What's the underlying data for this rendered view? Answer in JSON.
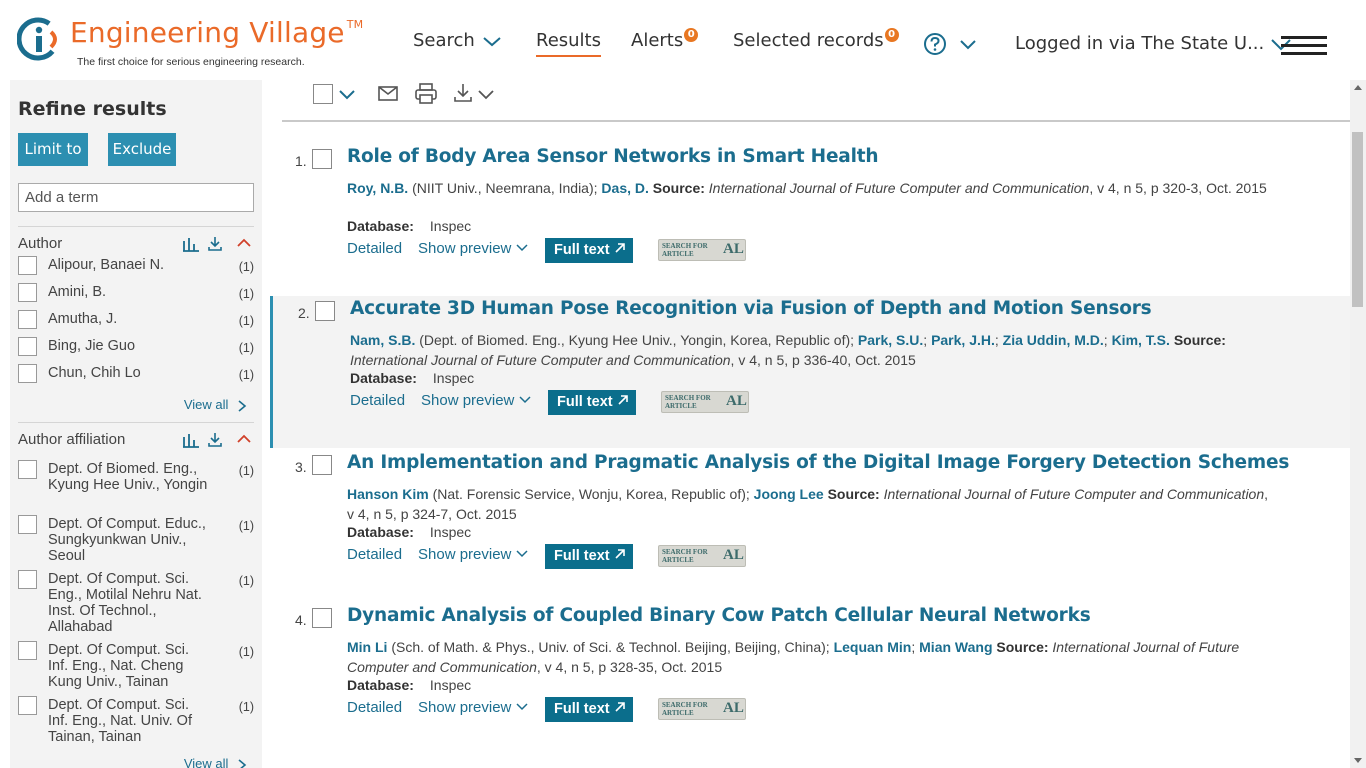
{
  "header": {
    "logo_title": "Engineering Village",
    "logo_tm": "TM",
    "logo_tagline": "The first choice for serious engineering research.",
    "nav_search": "Search",
    "nav_results": "Results",
    "nav_alerts": "Alerts",
    "alerts_count": "0",
    "nav_selected": "Selected records",
    "selected_count": "0",
    "login": "Logged in via The State U..."
  },
  "sidebar": {
    "title": "Refine results",
    "limit_label": "Limit to",
    "exclude_label": "Exclude",
    "term_placeholder": "Add a term",
    "author": {
      "label": "Author",
      "items": [
        {
          "name": "Alipour, Banaei N.",
          "count": "(1)"
        },
        {
          "name": "Amini, B.",
          "count": "(1)"
        },
        {
          "name": "Amutha, J.",
          "count": "(1)"
        },
        {
          "name": "Bing, Jie Guo",
          "count": "(1)"
        },
        {
          "name": "Chun, Chih Lo",
          "count": "(1)"
        }
      ],
      "view_all": "View all"
    },
    "affiliation": {
      "label": "Author affiliation",
      "items": [
        {
          "name": "Dept. Of Biomed. Eng., Kyung Hee Univ., Yongin",
          "count": "(1)"
        },
        {
          "name": "Dept. Of Comput. Educ., Sungkyunkwan Univ., Seoul",
          "count": "(1)"
        },
        {
          "name": "Dept. Of Comput. Sci. Eng., Motilal Nehru Nat. Inst. Of Technol., Allahabad",
          "count": "(1)"
        },
        {
          "name": "Dept. Of Comput. Sci. Inf. Eng., Nat. Cheng Kung Univ., Tainan",
          "count": "(1)"
        },
        {
          "name": "Dept. Of Comput. Sci. Inf. Eng., Nat. Univ. Of Tainan, Tainan",
          "count": "(1)"
        }
      ],
      "view_all": "View all"
    }
  },
  "results": [
    {
      "num": "1.",
      "title": "Role of Body Area Sensor Networks in Smart Health",
      "authors": [
        {
          "name": "Roy, N.B.",
          "aff": " (NIIT Univ., Neemrana, India); "
        },
        {
          "name": "Das, D.",
          "aff": " "
        }
      ],
      "source_label": "Source:",
      "journal": "International Journal of Future Computer and Communication",
      "details": ", v 4, n 5, p 320-3, Oct. 2015",
      "db_label": "Database:",
      "db": "Inspec"
    },
    {
      "num": "2.",
      "title": "Accurate 3D Human Pose Recognition via Fusion of Depth and Motion Sensors",
      "authors": [
        {
          "name": "Nam, S.B.",
          "aff": " (Dept. of Biomed. Eng., Kyung Hee Univ., Yongin, Korea, Republic of); "
        },
        {
          "name": "Park, S.U.",
          "aff": "; "
        },
        {
          "name": "Park, J.H.",
          "aff": "; "
        },
        {
          "name": "Zia Uddin, M.D.",
          "aff": "; "
        },
        {
          "name": "Kim, T.S.",
          "aff": " "
        }
      ],
      "source_label": "Source:",
      "journal": "International Journal of Future Computer and Communication",
      "details": ", v 4, n 5, p 336-40, Oct. 2015",
      "db_label": "Database:",
      "db": "Inspec"
    },
    {
      "num": "3.",
      "title": "An Implementation and Pragmatic Analysis of the Digital Image Forgery Detection Schemes",
      "authors": [
        {
          "name": "Hanson Kim",
          "aff": " (Nat. Forensic Service, Wonju, Korea, Republic of); "
        },
        {
          "name": "Joong Lee",
          "aff": " "
        }
      ],
      "source_label": "Source:",
      "journal": "International Journal of Future Computer and Communication",
      "details": ", v 4, n 5, p 324-7, Oct. 2015",
      "db_label": "Database:",
      "db": "Inspec"
    },
    {
      "num": "4.",
      "title": "Dynamic Analysis of Coupled Binary Cow Patch Cellular Neural Networks",
      "authors": [
        {
          "name": "Min Li",
          "aff": " (Sch. of Math. & Phys., Univ. of Sci. & Technol. Beijing, Beijing, China); "
        },
        {
          "name": "Lequan Min",
          "aff": "; "
        },
        {
          "name": "Mian Wang",
          "aff": " "
        }
      ],
      "source_label": "Source:",
      "journal": "International Journal of Future Computer and Communication",
      "details": ", v 4, n 5, p 328-35, Oct. 2015",
      "db_label": "Database:",
      "db": "Inspec"
    }
  ],
  "actions": {
    "detailed": "Detailed",
    "preview": "Show preview",
    "fulltext": "Full text",
    "sfa_line1": "SEARCH FOR",
    "sfa_line2": "ARTICLE",
    "sfa_al": "AL"
  },
  "colors": {
    "brand_orange": "#ea6a29",
    "link_teal": "#1b6d8e",
    "button_teal": "#2c8fb1",
    "fulltext_bg": "#0b6e8c"
  }
}
